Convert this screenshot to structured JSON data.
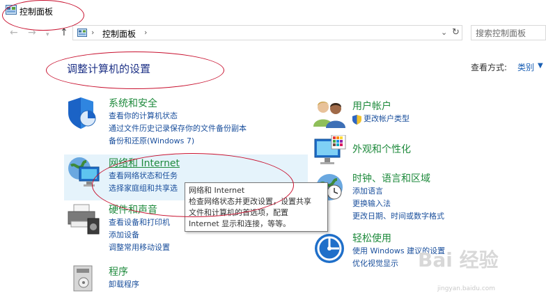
{
  "window": {
    "title": "控制面板"
  },
  "address": {
    "path": "控制面板"
  },
  "search": {
    "placeholder": "搜索控制面板"
  },
  "main": {
    "heading": "调整计算机的设置",
    "view_by_label": "查看方式:",
    "view_by_value": "类别"
  },
  "categories_left": [
    {
      "title": "系统和安全",
      "links": [
        "查看你的计算机状态",
        "通过文件历史记录保存你的文件备份副本",
        "备份和还原(Windows 7)"
      ]
    },
    {
      "title": "网络和 Internet",
      "links": [
        "查看网络状态和任务",
        "选择家庭组和共享选"
      ]
    },
    {
      "title": "硬件和声音",
      "links": [
        "查看设备和打印机",
        "添加设备",
        "调整常用移动设置"
      ]
    },
    {
      "title": "程序",
      "links": [
        "卸载程序"
      ]
    }
  ],
  "categories_right": [
    {
      "title": "用户帐户",
      "links": [
        "更改帐户类型"
      ]
    },
    {
      "title": "外观和个性化",
      "links": []
    },
    {
      "title": "时钟、语言和区域",
      "links": [
        "添加语言",
        "更换输入法",
        "更改日期、时间或数字格式"
      ]
    },
    {
      "title": "轻松使用",
      "links": [
        "使用 Windows 建议的设置",
        "优化视觉显示"
      ]
    }
  ],
  "tooltip": {
    "line1": "网络和 Internet",
    "line2": "检查网络状态并更改设置，设置共享",
    "line3": "文件和计算机的首选项，配置",
    "line4": "Internet 显示和连接，等等。"
  },
  "watermark": {
    "brand": "Bai 经验",
    "url": "jingyan.baidu.com"
  },
  "colors": {
    "category_title": "#1e8a3c",
    "link": "#1a4f9c",
    "heading": "#1e3287",
    "annotation": "#c8102e",
    "highlight": "#e5f3fb"
  }
}
